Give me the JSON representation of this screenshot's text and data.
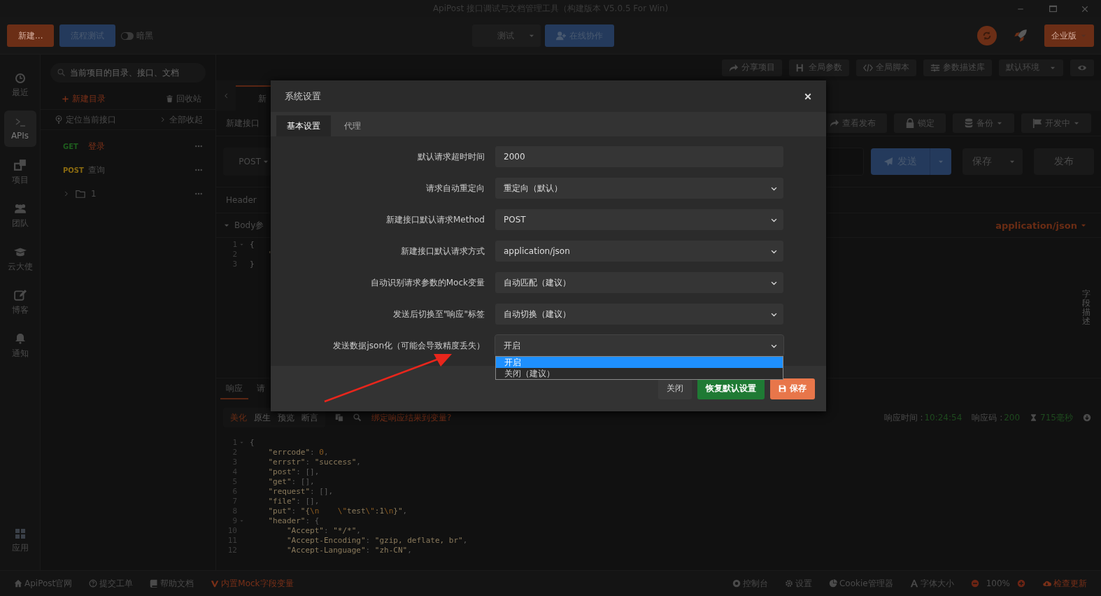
{
  "window": {
    "title": "ApiPost 接口调试与文档管理工具（构建版本 V5.0.5 For Win)"
  },
  "toolbar": {
    "new_button": "新建...",
    "flow_button": "流程测试",
    "dark_toggle": {
      "label": "暗黑",
      "on": false
    },
    "env_select": "测试",
    "collab_button": "在线协作",
    "edition_button": "企业版"
  },
  "nav": [
    {
      "label": "最近",
      "selected": false
    },
    {
      "label": "APIs",
      "selected": true
    },
    {
      "label": "项目",
      "selected": false
    },
    {
      "label": "团队",
      "selected": false
    },
    {
      "label": "云大使",
      "selected": false
    },
    {
      "label": "博客",
      "selected": false
    },
    {
      "label": "通知",
      "selected": false
    }
  ],
  "nav_bottom": {
    "label": "应用"
  },
  "tree": {
    "search_placeholder": "当前项目的目录、接口、文档",
    "new_folder": "新建目录",
    "trash": "回收站",
    "locate": "定位当前接口",
    "collapse": "全部收起",
    "items": [
      {
        "kind": "request",
        "method": "GET",
        "color": "#1e5e1e",
        "name": "登录",
        "selected": true
      },
      {
        "kind": "request",
        "method": "POST",
        "color": "#8a6a10",
        "name": "查询",
        "selected": false
      },
      {
        "kind": "folder",
        "name": "1",
        "expanded": false
      }
    ]
  },
  "project_toolbar": {
    "buttons": [
      "分享项目",
      "全局参数",
      "全局脚本",
      "参数描述库"
    ],
    "env_select": "默认环境"
  },
  "tabs": [
    {
      "label": "新",
      "selected": true
    }
  ],
  "api": {
    "title": "新建接口",
    "actions": [
      {
        "label": "查看发布",
        "dropdown": false
      },
      {
        "label": "锁定",
        "dropdown": false
      },
      {
        "label": "备份",
        "dropdown": true
      },
      {
        "label": "开发中",
        "dropdown": true
      }
    ]
  },
  "request": {
    "method": "POST",
    "send": "发送",
    "save": "保存",
    "publish": "发布"
  },
  "header_tab": "Header",
  "body_label": "Body参",
  "content_type": "application/json",
  "body_lines": [
    {
      "num": "1",
      "fold": true,
      "tokens": [
        {
          "kind": "punct",
          "t": "{"
        }
      ]
    },
    {
      "num": "2",
      "fold": false,
      "tokens": [
        {
          "kind": "string",
          "t": "    \""
        }
      ]
    },
    {
      "num": "3",
      "fold": false,
      "tokens": [
        {
          "kind": "punct",
          "t": "}"
        }
      ]
    }
  ],
  "side_label": "字段描述",
  "response": {
    "tabs": [
      {
        "label": "响应",
        "selected": true
      },
      {
        "label": "请",
        "selected": false
      }
    ],
    "view_modes": [
      {
        "label": "美化",
        "selected": true
      },
      {
        "label": "原生",
        "selected": false
      },
      {
        "label": "预览",
        "selected": false
      },
      {
        "label": "断言",
        "selected": false
      }
    ],
    "bind_link": "绑定响应结果到变量?",
    "time_label": "响应时间 :",
    "time": "10:24:54",
    "code_label": "响应码 :",
    "code": "200",
    "duration": "715毫秒",
    "lines": [
      {
        "num": "1",
        "fold": true,
        "tokens": [
          {
            "kind": "punct",
            "t": "{"
          }
        ]
      },
      {
        "num": "2",
        "fold": false,
        "tokens": [
          {
            "kind": "key",
            "t": "    \"errcode\""
          },
          {
            "kind": "punct",
            "t": ": "
          },
          {
            "kind": "number",
            "t": "0"
          },
          {
            "kind": "punct",
            "t": ","
          }
        ]
      },
      {
        "num": "3",
        "fold": false,
        "tokens": [
          {
            "kind": "key",
            "t": "    \"errstr\""
          },
          {
            "kind": "punct",
            "t": ": "
          },
          {
            "kind": "string",
            "t": "\"success\""
          },
          {
            "kind": "punct",
            "t": ","
          }
        ]
      },
      {
        "num": "4",
        "fold": false,
        "tokens": [
          {
            "kind": "key",
            "t": "    \"post\""
          },
          {
            "kind": "punct",
            "t": ": [],"
          }
        ]
      },
      {
        "num": "5",
        "fold": false,
        "tokens": [
          {
            "kind": "key",
            "t": "    \"get\""
          },
          {
            "kind": "punct",
            "t": ": [],"
          }
        ]
      },
      {
        "num": "6",
        "fold": false,
        "tokens": [
          {
            "kind": "key",
            "t": "    \"request\""
          },
          {
            "kind": "punct",
            "t": ": [],"
          }
        ]
      },
      {
        "num": "7",
        "fold": false,
        "tokens": [
          {
            "kind": "key",
            "t": "    \"file\""
          },
          {
            "kind": "punct",
            "t": ": [],"
          }
        ]
      },
      {
        "num": "8",
        "fold": false,
        "tokens": [
          {
            "kind": "key",
            "t": "    \"put\""
          },
          {
            "kind": "punct",
            "t": ": "
          },
          {
            "kind": "string",
            "t": "\"{"
          },
          {
            "kind": "escape",
            "t": "\\n    \\\""
          },
          {
            "kind": "string",
            "t": "test"
          },
          {
            "kind": "escape",
            "t": "\\\""
          },
          {
            "kind": "string",
            "t": ":1"
          },
          {
            "kind": "escape",
            "t": "\\n"
          },
          {
            "kind": "string",
            "t": "}\""
          },
          {
            "kind": "punct",
            "t": ","
          }
        ]
      },
      {
        "num": "9",
        "fold": true,
        "tokens": [
          {
            "kind": "key",
            "t": "    \"header\""
          },
          {
            "kind": "punct",
            "t": ": {"
          }
        ]
      },
      {
        "num": "10",
        "fold": false,
        "tokens": [
          {
            "kind": "key",
            "t": "        \"Accept\""
          },
          {
            "kind": "punct",
            "t": ": "
          },
          {
            "kind": "string",
            "t": "\"*/*\""
          },
          {
            "kind": "punct",
            "t": ","
          }
        ]
      },
      {
        "num": "11",
        "fold": false,
        "tokens": [
          {
            "kind": "key",
            "t": "        \"Accept-Encoding\""
          },
          {
            "kind": "punct",
            "t": ": "
          },
          {
            "kind": "string",
            "t": "\"gzip, deflate, br\""
          },
          {
            "kind": "punct",
            "t": ","
          }
        ]
      },
      {
        "num": "12",
        "fold": false,
        "tokens": [
          {
            "kind": "key",
            "t": "        \"Accept-Language\""
          },
          {
            "kind": "punct",
            "t": ": "
          },
          {
            "kind": "string",
            "t": "\"zh-CN\""
          },
          {
            "kind": "punct",
            "t": ","
          }
        ]
      }
    ]
  },
  "status_bar": {
    "left": [
      {
        "label": "ApiPost官网",
        "highlight": false
      },
      {
        "label": "提交工单",
        "highlight": false
      },
      {
        "label": "帮助文档",
        "highlight": false
      },
      {
        "label": "内置Mock字段变量",
        "highlight": true
      }
    ],
    "right": [
      {
        "label": "控制台",
        "highlight": false
      },
      {
        "label": "设置",
        "highlight": false
      },
      {
        "label": "Cookie管理器",
        "highlight": false
      },
      {
        "label": "字体大小",
        "highlight": false
      }
    ],
    "zoom": "100%",
    "update": "检查更新"
  },
  "modal": {
    "title": "系统设置",
    "tabs": [
      {
        "label": "基本设置",
        "selected": true
      },
      {
        "label": "代理",
        "selected": false
      }
    ],
    "fields": [
      {
        "label": "默认请求超时时间",
        "kind": "input",
        "value": "2000"
      },
      {
        "label": "请求自动重定向",
        "kind": "select",
        "value": "重定向（默认）",
        "expanded": false
      },
      {
        "label": "新建接口默认请求Method",
        "kind": "select",
        "value": "POST",
        "expanded": false
      },
      {
        "label": "新建接口默认请求方式",
        "kind": "select",
        "value": "application/json",
        "expanded": false
      },
      {
        "label": "自动识别请求参数的Mock变量",
        "kind": "select",
        "value": "自动匹配（建议）",
        "expanded": false
      },
      {
        "label": "发送后切换至\"响应\"标签",
        "kind": "select",
        "value": "自动切换（建议）",
        "expanded": false
      },
      {
        "label": "发送数据json化（可能会导致精度丢失）",
        "kind": "select",
        "value": "开启",
        "expanded": true,
        "options": [
          {
            "label": "开启",
            "selected": true
          },
          {
            "label": "关闭（建议）",
            "selected": false
          }
        ]
      }
    ],
    "buttons": [
      {
        "label": "关闭",
        "kind": "default"
      },
      {
        "label": "恢复默认设置",
        "kind": "success"
      },
      {
        "label": "保存",
        "kind": "primary"
      }
    ]
  }
}
